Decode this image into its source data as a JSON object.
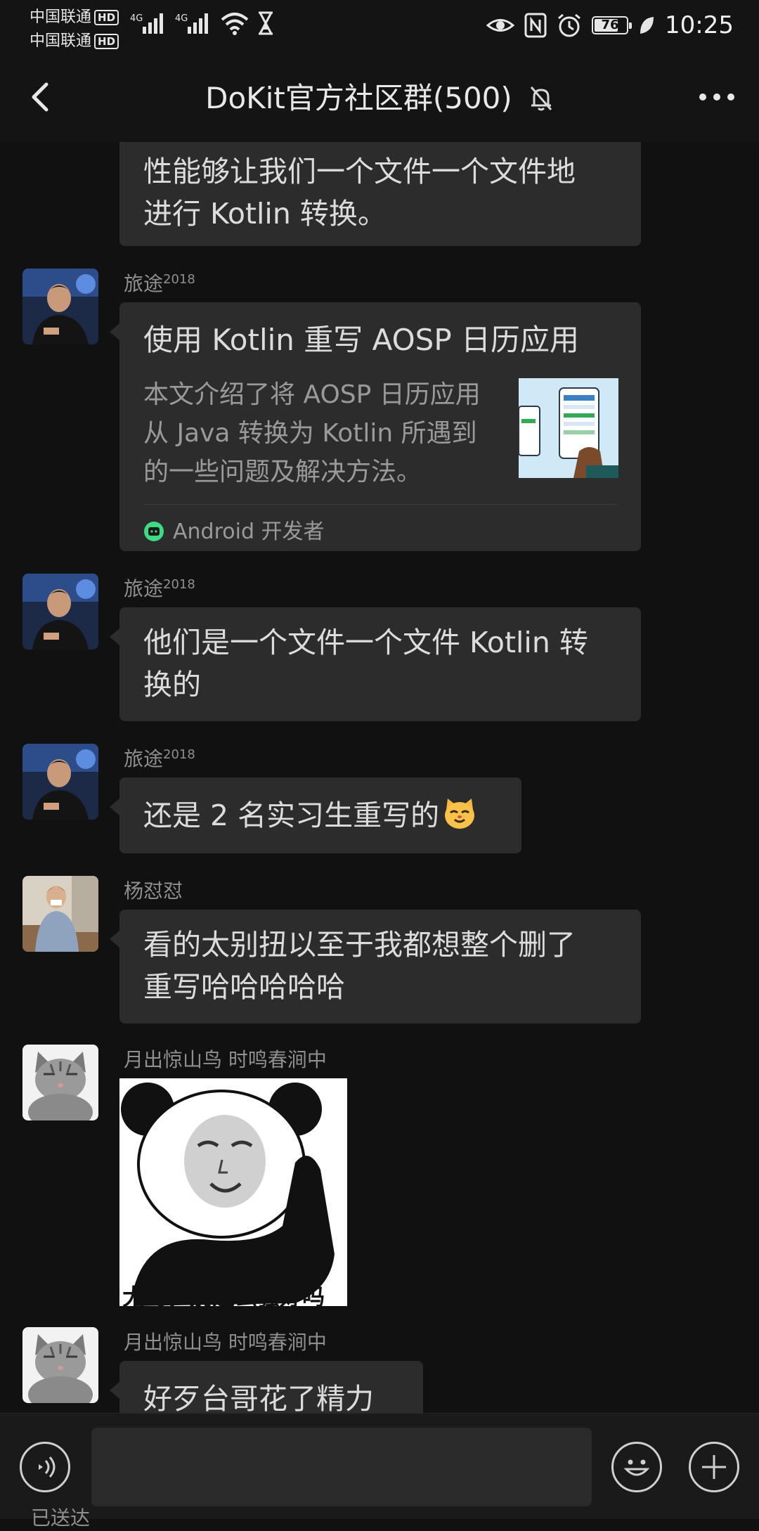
{
  "status_bar": {
    "carrier_1": "中国联通",
    "carrier_2": "中国联通",
    "hd_label": "HD",
    "network_1": "4G",
    "network_2": "4G",
    "battery": "76",
    "battery_level": 0.76,
    "time": "10:25"
  },
  "header": {
    "title": "DoKit官方社区群(500)"
  },
  "messages": {
    "m0": {
      "line1": "性能够让我们一个文件一个文件地",
      "line2": "进行 Kotlin 转换。"
    },
    "m1": {
      "sender_name": "旅途",
      "sender_sup": "2018",
      "card_title": "使用 Kotlin 重写 AOSP 日历应用",
      "card_desc_1": "本文介绍了将 AOSP 日历应用",
      "card_desc_2": "从 Java 转换为 Kotlin 所遇到",
      "card_desc_3": "的一些问题及解决方法。",
      "card_source": "Android 开发者"
    },
    "m2": {
      "sender_name": "旅途",
      "sender_sup": "2018",
      "line1": "他们是一个文件一个文件 Kotlin 转",
      "line2": "换的"
    },
    "m3": {
      "sender_name": "旅途",
      "sender_sup": "2018",
      "line1": "还是 2 名实习生重写的"
    },
    "m4": {
      "sender_name": "杨怼怼",
      "line1": "看的太别扭以至于我都想整个删了",
      "line2": "重写哈哈哈哈哈"
    },
    "m5": {
      "sender_name": "月出惊山鸟  时鸣春涧中",
      "meme_caption": "大哥，别这么骚好吗"
    },
    "m6": {
      "sender_name": "月出惊山鸟  时鸣春涧中",
      "line1": "好歹台哥花了精力"
    }
  },
  "bottom": {
    "partial_text": "已送达"
  },
  "icons": {
    "back": "chevron-left-icon",
    "mute": "bell-off-icon",
    "more": "more-dots-icon",
    "voice": "voice-icon",
    "emoji": "emoji-icon",
    "plus": "plus-icon"
  }
}
